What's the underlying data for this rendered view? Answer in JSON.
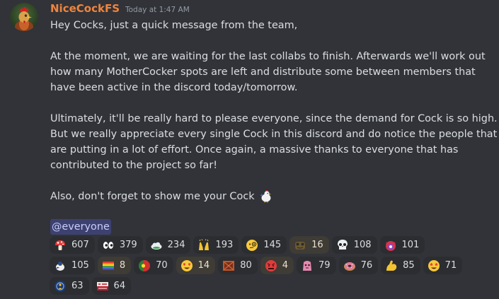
{
  "message": {
    "author": "NiceCockFS",
    "author_color": "#f0843c",
    "timestamp": "Today at 1:47 AM",
    "avatar_icon": "rooster-icon",
    "paragraphs": [
      [
        "Hey Cocks, just a quick message from the team,"
      ],
      [
        "At the moment, we are waiting for the last collabs to finish. Afterwards we'll work out",
        "how many MotherCocker spots are left and distribute some between members that",
        "have been active in the discord today/tomorrow."
      ],
      [
        "Ultimately, it'll be really hard to please everyone, since the demand for Cock is so high.",
        "But we really appreciate every single Cock in this discord and do notice the people that",
        "are putting in a lot of effort. Once again, a massive thanks to everyone that has",
        "contributed to the project so far!"
      ]
    ],
    "closing_line": "Also, don't forget to show me your Cock",
    "closing_emoji": "rooster-emoji",
    "mention": "@everyone"
  },
  "reactions": [
    {
      "emoji": "mushroom-emoji",
      "count": "607",
      "active": false
    },
    {
      "emoji": "eyes-emoji",
      "count": "379",
      "active": false
    },
    {
      "emoji": "cloud-emoji",
      "count": "234",
      "active": false
    },
    {
      "emoji": "raised-hands-emoji",
      "count": "193",
      "active": false
    },
    {
      "emoji": "monocle-face-emoji",
      "count": "145",
      "active": false
    },
    {
      "emoji": "custom-frog-emoji",
      "count": "16",
      "active": true
    },
    {
      "emoji": "skull-emoji",
      "count": "108",
      "active": false
    },
    {
      "emoji": "devil-emoji",
      "count": "101",
      "active": false
    },
    {
      "emoji": "custom-bird-emoji",
      "count": "105",
      "active": false
    },
    {
      "emoji": "rainbow-flag-emoji",
      "count": "8",
      "active": true
    },
    {
      "emoji": "portugal-flag-emoji",
      "count": "70",
      "active": false
    },
    {
      "emoji": "heart-eyes-emoji",
      "count": "14",
      "active": true
    },
    {
      "emoji": "custom-frame-emoji",
      "count": "80",
      "active": false
    },
    {
      "emoji": "angry-face-emoji",
      "count": "4",
      "active": true
    },
    {
      "emoji": "custom-pink-emoji",
      "count": "79",
      "active": false
    },
    {
      "emoji": "donut-emoji",
      "count": "76",
      "active": false
    },
    {
      "emoji": "flexed-biceps-emoji",
      "count": "85",
      "active": false
    },
    {
      "emoji": "star-struck-emoji",
      "count": "71",
      "active": false
    },
    {
      "emoji": "custom-blue-emoji",
      "count": "63",
      "active": false
    },
    {
      "emoji": "custom-banner-emoji",
      "count": "64",
      "active": false
    }
  ],
  "colors": {
    "background": "#313338",
    "reaction_bg": "#2b2d31",
    "reaction_active_bg": "#3f3b35",
    "mention_bg": "#5865f2",
    "text": "#dbdee1",
    "timestamp": "#949ba4"
  }
}
